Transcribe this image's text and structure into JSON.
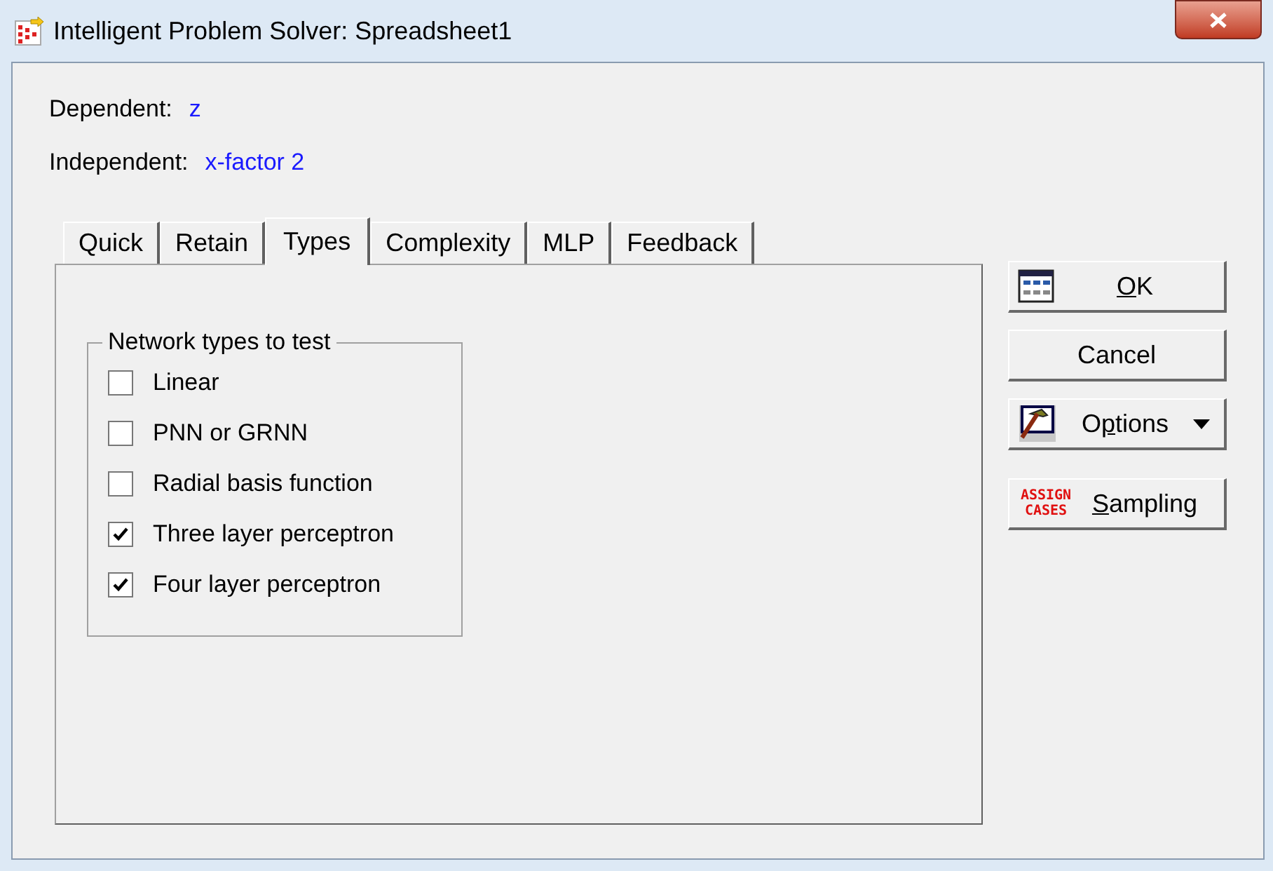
{
  "window": {
    "title": "Intelligent Problem Solver: Spreadsheet1"
  },
  "fields": [
    {
      "label": "Dependent:",
      "value": "z"
    },
    {
      "label": "Independent:",
      "value": "x-factor 2"
    }
  ],
  "tabs": [
    {
      "label": "Quick",
      "selected": false
    },
    {
      "label": "Retain",
      "selected": false
    },
    {
      "label": "Types",
      "selected": true
    },
    {
      "label": "Complexity",
      "selected": false
    },
    {
      "label": "MLP",
      "selected": false
    },
    {
      "label": "Feedback",
      "selected": false
    }
  ],
  "group": {
    "title": "Network types to test",
    "options": [
      {
        "label": "Linear",
        "checked": false
      },
      {
        "label": "PNN or GRNN",
        "checked": false
      },
      {
        "label": "Radial basis function",
        "checked": false
      },
      {
        "label": "Three layer perceptron",
        "checked": true
      },
      {
        "label": "Four layer perceptron",
        "checked": true
      }
    ]
  },
  "buttons": [
    {
      "kind": "grid",
      "label_parts": [
        {
          "text": "O",
          "underlined": true
        },
        {
          "text": "K",
          "underlined": false
        }
      ]
    },
    {
      "kind": "plain",
      "label_parts": [
        {
          "text": "Cancel",
          "underlined": false
        }
      ]
    },
    {
      "kind": "hammer",
      "label_parts": [
        {
          "text": "O",
          "underlined": false
        },
        {
          "text": "p",
          "underlined": true
        },
        {
          "text": "tions",
          "underlined": false
        }
      ]
    },
    {
      "kind": "assign",
      "label_parts": [
        {
          "text": "S",
          "underlined": true
        },
        {
          "text": "ampling",
          "underlined": false
        }
      ],
      "icon_text": [
        "ASSIGN",
        "CASES"
      ]
    }
  ]
}
